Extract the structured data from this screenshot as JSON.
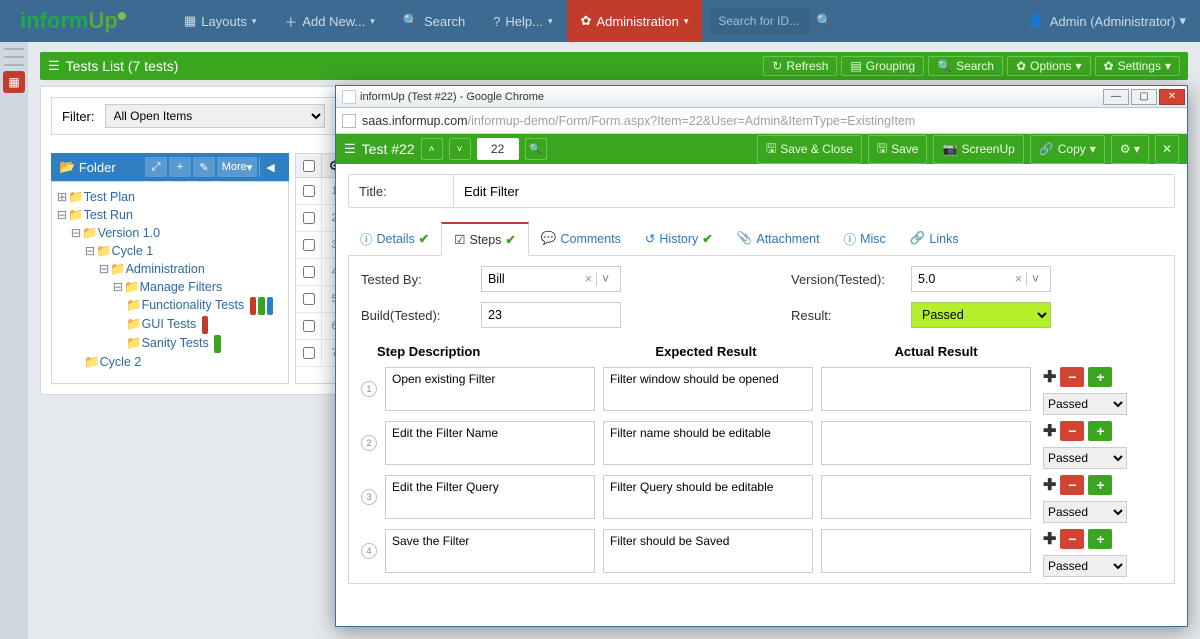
{
  "brand": "informUp",
  "nav": {
    "layouts": "Layouts",
    "addnew": "Add New...",
    "search": "Search",
    "help": "Help...",
    "admin": "Administration",
    "search_ph": "Search for ID...",
    "user": "Admin (Administrator)"
  },
  "tests_bar": {
    "title": "Tests List  (7 tests)",
    "refresh": "Refresh",
    "grouping": "Grouping",
    "search": "Search",
    "options": "Options",
    "settings": "Settings"
  },
  "filter": {
    "label": "Filter:",
    "value": "All Open Items"
  },
  "folder": {
    "title": "Folder",
    "more": "More",
    "tree": {
      "tp": "Test Plan",
      "tr": "Test Run",
      "v1": "Version 1.0",
      "c1": "Cycle 1",
      "adm": "Administration",
      "mf": "Manage Filters",
      "ft": "Functionality Tests",
      "gt": "GUI Tests",
      "st": "Sanity Tests",
      "c2": "Cycle 2"
    }
  },
  "grid_rows": [
    "1",
    "2",
    "3",
    "4",
    "5",
    "6",
    "7"
  ],
  "popup": {
    "wintitle": "informUp (Test #22) - Google Chrome",
    "host": "saas.informup.com",
    "path": "/informup-demo/Form/Form.aspx?Item=22&User=Admin&ItemType=ExistingItem",
    "bar_title": "Test #22",
    "num": "22",
    "save_close": "Save & Close",
    "save": "Save",
    "screenup": "ScreenUp",
    "copy": "Copy",
    "title_lab": "Title:",
    "title_val": "Edit Filter",
    "tabs": {
      "details": "Details",
      "steps": "Steps",
      "comments": "Comments",
      "history": "History",
      "attach": "Attachment",
      "misc": "Misc",
      "links": "Links"
    },
    "fields": {
      "tested_by_l": "Tested By:",
      "tested_by_v": "Bill",
      "version_l": "Version(Tested):",
      "version_v": "5.0",
      "build_l": "Build(Tested):",
      "build_v": "23",
      "result_l": "Result:",
      "result_v": "Passed"
    },
    "steps_head": {
      "c1": "Step Description",
      "c2": "Expected Result",
      "c3": "Actual Result"
    },
    "steps": [
      {
        "n": "1",
        "desc": "Open existing Filter",
        "exp": "Filter window should be opened",
        "act": "",
        "res": "Passed"
      },
      {
        "n": "2",
        "desc": "Edit the Filter Name",
        "exp": "Filter name should be editable",
        "act": "",
        "res": "Passed"
      },
      {
        "n": "3",
        "desc": "Edit the Filter Query",
        "exp": "Filter Query should be editable",
        "act": "",
        "res": "Passed"
      },
      {
        "n": "4",
        "desc": "Save the Filter",
        "exp": "Filter should be Saved",
        "act": "",
        "res": "Passed"
      }
    ]
  }
}
